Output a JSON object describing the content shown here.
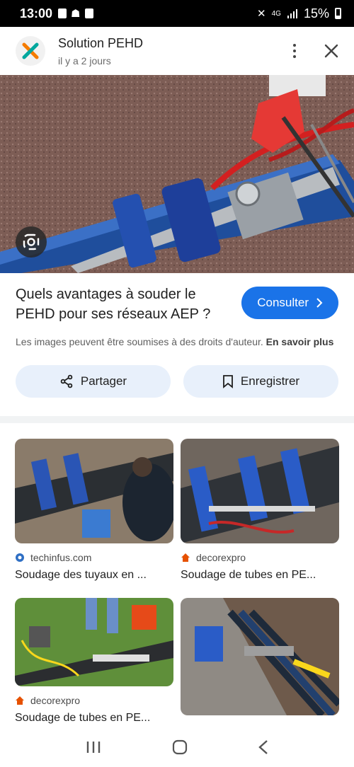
{
  "status": {
    "time": "13:00",
    "net_label": "4G",
    "battery": "15%"
  },
  "header": {
    "title": "Solution PEHD",
    "subtitle": "il y a 2 jours"
  },
  "colors": {
    "accent": "#1a73e8",
    "pill_bg": "#e8f0fb"
  },
  "info": {
    "headline": "Quels avantages à souder le PEHD pour ses réseaux AEP ?",
    "consult_label": "Consulter",
    "copyright": "Les images peuvent être soumises à des droits d'auteur.",
    "learn_more": "En savoir plus",
    "share_label": "Partager",
    "save_label": "Enregistrer"
  },
  "results": [
    {
      "source": "techinfus.com",
      "title": "Soudage des tuyaux en ..."
    },
    {
      "source": "decorexpro",
      "title": "Soudage de tubes en PE..."
    },
    {
      "source": "decorexpro",
      "title": "Soudage de tubes en PE..."
    },
    {
      "source": "",
      "title": ""
    }
  ]
}
